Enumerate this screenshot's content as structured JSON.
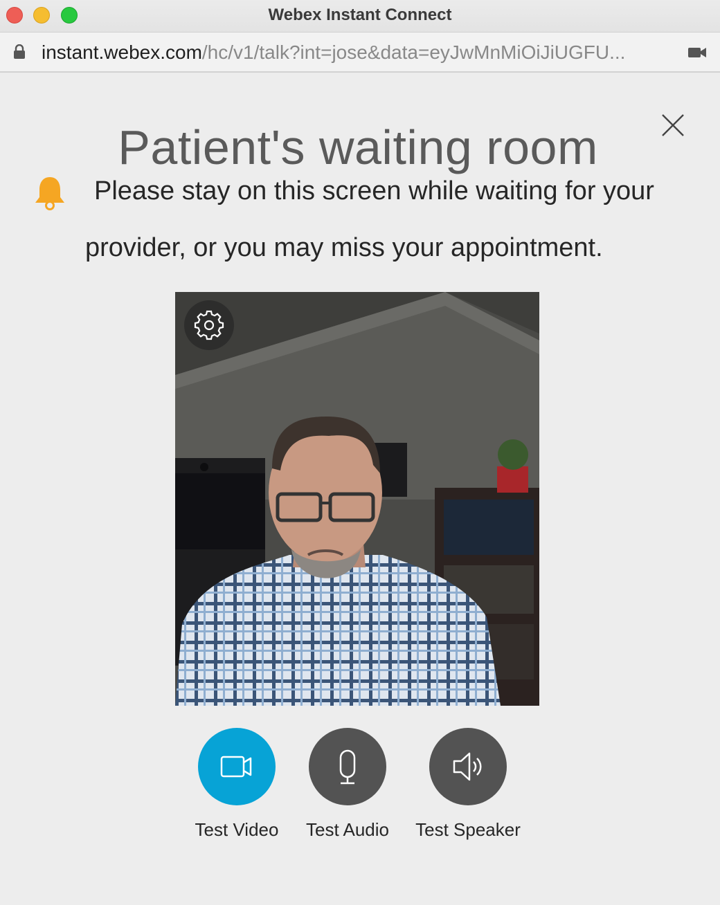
{
  "window": {
    "title": "Webex Instant Connect"
  },
  "address_bar": {
    "url_host": "instant.webex.com",
    "url_path": "/hc/v1/talk?int=jose&data=eyJwMnMiOiJiUGFU..."
  },
  "icons": {
    "lock": "lock-icon",
    "camera": "camera-icon",
    "close": "close-icon",
    "bell": "bell-icon",
    "settings": "gear-icon",
    "video": "video-camera-icon",
    "microphone": "microphone-icon",
    "speaker": "speaker-icon"
  },
  "colors": {
    "accent": "#07a3d6",
    "control_dark": "#535353",
    "bell": "#f5a623"
  },
  "main": {
    "title": "Patient's waiting room",
    "notice_line1": "Please stay on this screen while waiting for your",
    "notice_line2": "provider, or you may miss your appointment."
  },
  "controls": [
    {
      "label": "Test Video",
      "active": true
    },
    {
      "label": "Test Audio",
      "active": false
    },
    {
      "label": "Test Speaker",
      "active": false
    }
  ]
}
